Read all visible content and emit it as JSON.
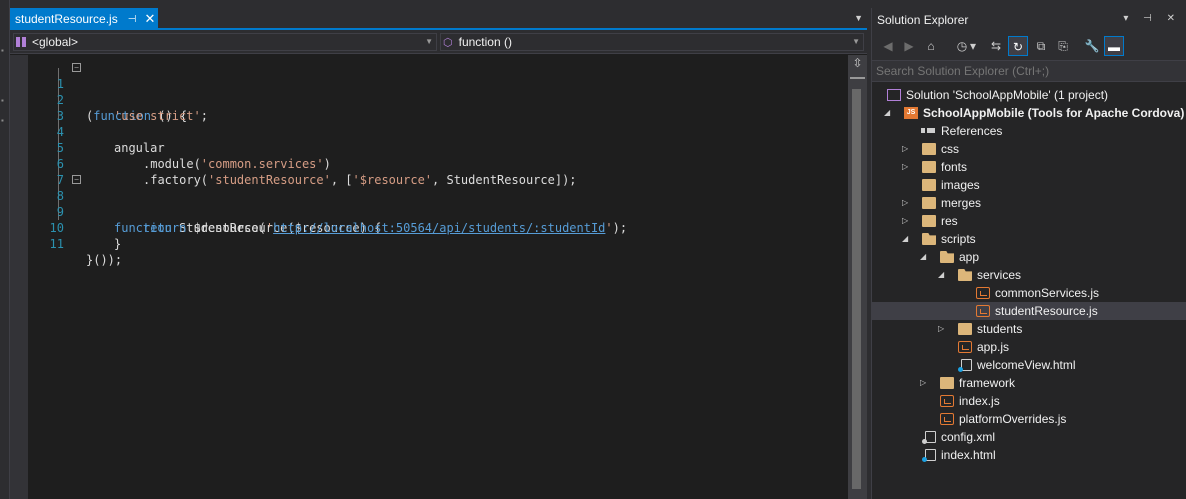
{
  "editor": {
    "tab": {
      "title": "studentResource.js",
      "pin_glyph": "⊣",
      "close_glyph": "✕"
    },
    "tab_dropdown_glyph": "▼",
    "nav": {
      "scope": "<global>",
      "member": "function ()"
    },
    "lines": [
      {
        "n": "1",
        "fold": "−"
      },
      {
        "n": "2"
      },
      {
        "n": "3"
      },
      {
        "n": "4"
      },
      {
        "n": "5"
      },
      {
        "n": "6"
      },
      {
        "n": "7"
      },
      {
        "n": "8",
        "fold": "−"
      },
      {
        "n": "9"
      },
      {
        "n": "10"
      },
      {
        "n": "11"
      }
    ],
    "code": {
      "l1_a": "(",
      "l1_kw": "function",
      "l1_b": " () {",
      "l2_str": "'use strict'",
      "l2_b": ";",
      "l4": "angular",
      "l5_a": ".module(",
      "l5_str": "'common.services'",
      "l5_b": ")",
      "l6_a": ".factory(",
      "l6_str1": "'studentResource'",
      "l6_b": ", [",
      "l6_str2": "'$resource'",
      "l6_c": ", StudentResource]);",
      "l8_kw": "function",
      "l8_b": " StudentResource($resource) {",
      "l9_kw": "return",
      "l9_a": " $resource(",
      "l9_q1": "'",
      "l9_url": "http://localhost:50564/api/students/:studentId",
      "l9_q2": "'",
      "l9_b": ");",
      "l10": "}",
      "l11": "}());"
    }
  },
  "solution_explorer": {
    "title": "Solution Explorer",
    "title_icons": "▾ ⊣ ✕",
    "search_placeholder": "Search Solution Explorer (Ctrl+;)",
    "toolbar": {
      "back": "◀",
      "forward": "▶",
      "home": "⌂",
      "history": "◷",
      "history_drop": "▾",
      "sync": "⇆",
      "refresh": "↻",
      "collapse": "⧉",
      "show_all": "⎘",
      "properties": "🔧",
      "preview": "▬"
    },
    "tree": {
      "solution": "Solution 'SchoolAppMobile' (1 project)",
      "project": "SchoolAppMobile (Tools for Apache Cordova)",
      "project_badge": "JS",
      "references": "References",
      "css": "css",
      "fonts": "fonts",
      "images": "images",
      "merges": "merges",
      "res": "res",
      "scripts": "scripts",
      "app": "app",
      "services": "services",
      "commonServices": "commonServices.js",
      "studentResource": "studentResource.js",
      "students": "students",
      "appjs": "app.js",
      "welcomeView": "welcomeView.html",
      "framework": "framework",
      "indexjs": "index.js",
      "platformOverrides": "platformOverrides.js",
      "configxml": "config.xml",
      "indexhtml": "index.html"
    },
    "expander_collapsed": "▷",
    "expander_expanded": "◢"
  }
}
